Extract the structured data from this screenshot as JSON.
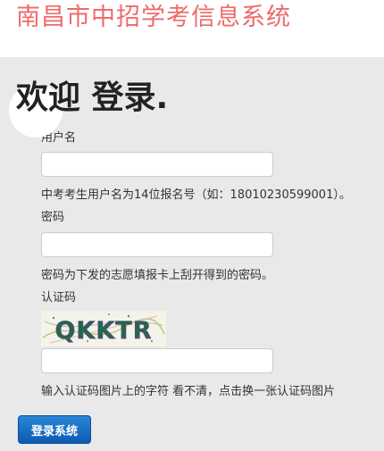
{
  "header": {
    "site_title": "南昌市中招学考信息系统"
  },
  "main": {
    "welcome": "欢迎 登录."
  },
  "form": {
    "username": {
      "label": "用户名",
      "value": "",
      "placeholder": "",
      "help": "中考考生用户名为14位报名号（如：18010230599001）。"
    },
    "password": {
      "label": "密码",
      "value": "",
      "placeholder": "",
      "help": "密码为下发的志愿填报卡上刮开得到的密码。"
    },
    "captcha": {
      "label": "认证码",
      "image_text": "QKKTR",
      "value": "",
      "placeholder": "",
      "help": "输入认证码图片上的字符 看不清，点击换一张认证码图片"
    },
    "submit_label": "登录系统"
  },
  "colors": {
    "title": "#f06a6a",
    "panel_background": "#e9e9e9",
    "button_top": "#2a86d8",
    "button_bottom": "#0d5bb0"
  }
}
